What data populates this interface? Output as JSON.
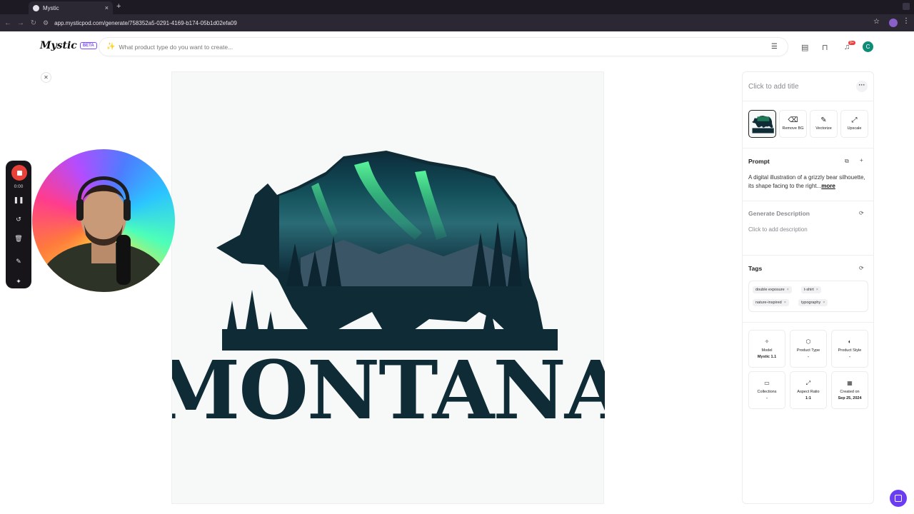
{
  "browser": {
    "tab_title": "Mystic",
    "tab_close": "×",
    "new_tab": "+",
    "url": "app.mysticpod.com/generate/758352a5-0291-4169-b174-05b1d02efa09"
  },
  "header": {
    "logo": "Mystic",
    "beta": "BETA",
    "search_placeholder": "What product type do you want to create...",
    "notification_badge": "9+",
    "avatar_initial": "C"
  },
  "recorder": {
    "time": "0:00"
  },
  "canvas": {
    "image_text": "MONTANA"
  },
  "panel": {
    "title": "Click to add title",
    "tools": [
      {
        "label": "Remove BG",
        "icon": "eraser-icon"
      },
      {
        "label": "Vectorize",
        "icon": "pen-icon"
      },
      {
        "label": "Upscale",
        "icon": "upscale-icon"
      }
    ],
    "prompt_heading": "Prompt",
    "prompt_text": "A digital illustration of a grizzly bear silhouette, its shape facing to the right...",
    "prompt_more": "more",
    "description_heading": "Generate Description",
    "description_placeholder": "Click to add description",
    "tags_heading": "Tags",
    "tags": [
      "double exposure",
      "t-shirt",
      "nature-inspired",
      "typography"
    ],
    "info": [
      {
        "label": "Model",
        "value": "Mystic 1.1",
        "icon": "magic-wand-icon"
      },
      {
        "label": "Product Type",
        "value": "-",
        "icon": "box-icon"
      },
      {
        "label": "Product Style",
        "value": "-",
        "icon": "palette-icon"
      },
      {
        "label": "Collections",
        "value": "-",
        "icon": "folder-icon"
      },
      {
        "label": "Aspect Ratio",
        "value": "1:1",
        "icon": "expand-icon"
      },
      {
        "label": "Created on",
        "value": "Sep 25, 2024",
        "icon": "calendar-icon"
      }
    ]
  },
  "colors": {
    "accent": "#7c4dff",
    "record": "#e8413a",
    "chat": "#6a3df5",
    "avatar": "#0f8c78"
  }
}
